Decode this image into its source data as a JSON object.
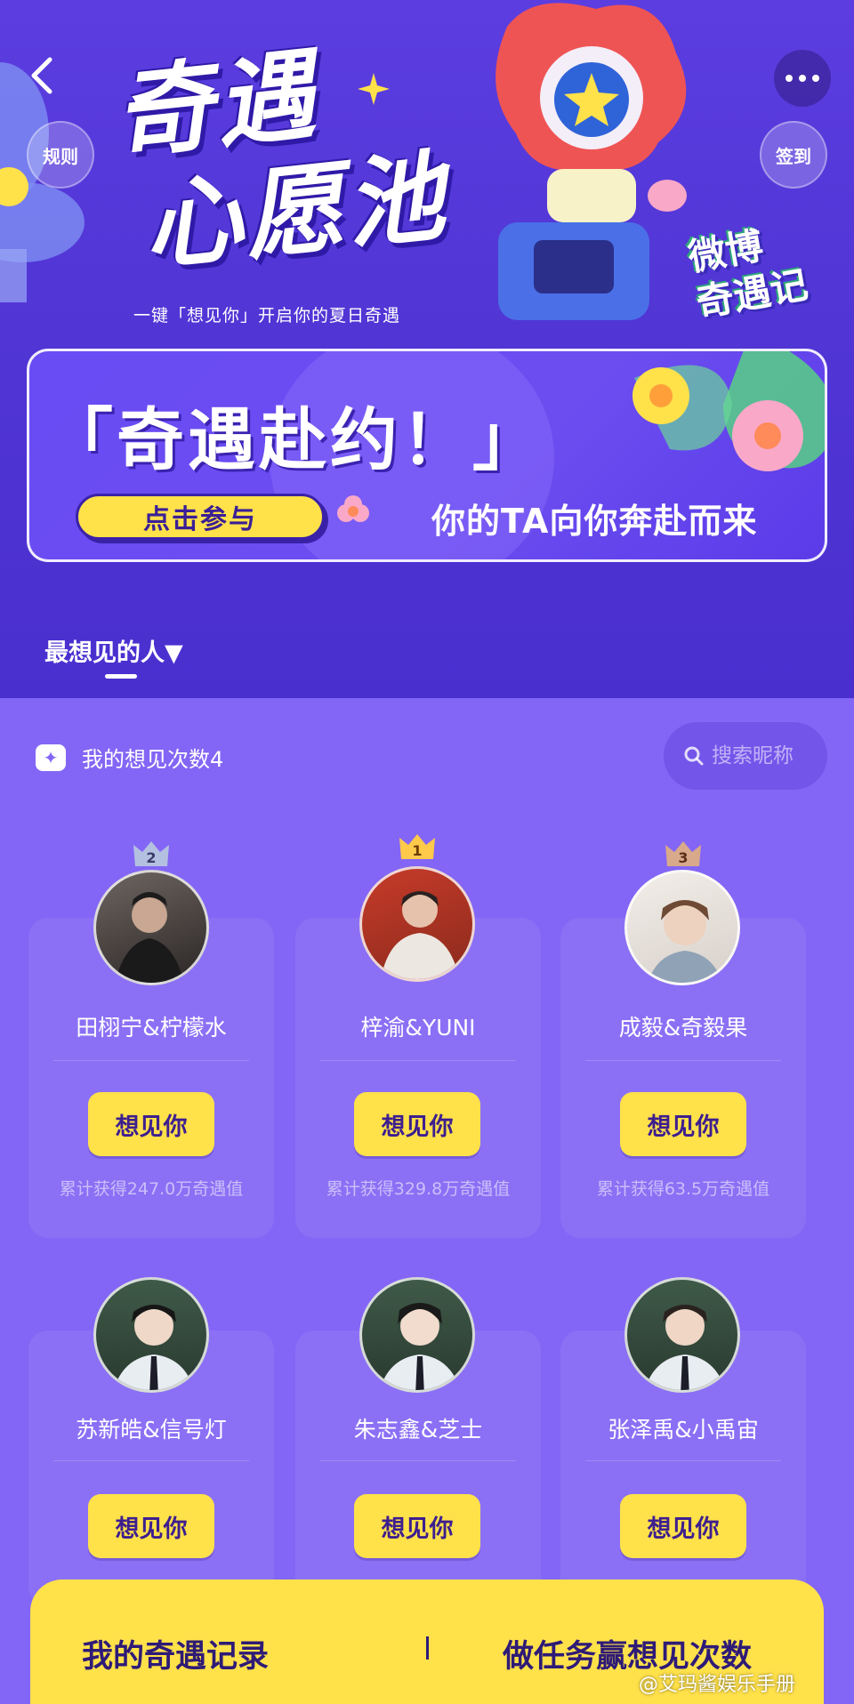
{
  "header": {
    "title_line1": "奇遇",
    "title_line2": "心愿池",
    "subtitle": "一键「想见你」开启你的夏日奇遇",
    "rules_label": "规则",
    "checkin_label": "签到",
    "brand_line1": "微博",
    "brand_line2": "奇遇记"
  },
  "promo": {
    "title": "「奇遇赴约！」",
    "join_label": "点击参与",
    "tagline": "你的TA向你奔赴而来"
  },
  "tab": {
    "label": "最想见的人▼"
  },
  "stats": {
    "meet_count": "我的想见次数4"
  },
  "search": {
    "placeholder": "搜索昵称"
  },
  "cards": [
    {
      "rank": "2",
      "name": "田栩宁&柠檬水",
      "button": "想见你",
      "points": "累计获得247.0万奇遇值"
    },
    {
      "rank": "1",
      "name": "梓渝&YUNI",
      "button": "想见你",
      "points": "累计获得329.8万奇遇值"
    },
    {
      "rank": "3",
      "name": "成毅&奇毅果",
      "button": "想见你",
      "points": "累计获得63.5万奇遇值"
    },
    {
      "name": "苏新皓&信号灯",
      "button": "想见你"
    },
    {
      "name": "朱志鑫&芝士",
      "button": "想见你"
    },
    {
      "name": "张泽禹&小禹宙",
      "button": "想见你"
    }
  ],
  "bottom": {
    "left_label": "我的奇遇记录",
    "right_label": "做任务赢想见次数"
  },
  "watermark": "@艾玛酱娱乐手册",
  "colors": {
    "background": "#7b5cf0",
    "header": "#5236d6",
    "accent_yellow": "#ffe14a",
    "dark_purple_text": "#3d1f8f"
  }
}
